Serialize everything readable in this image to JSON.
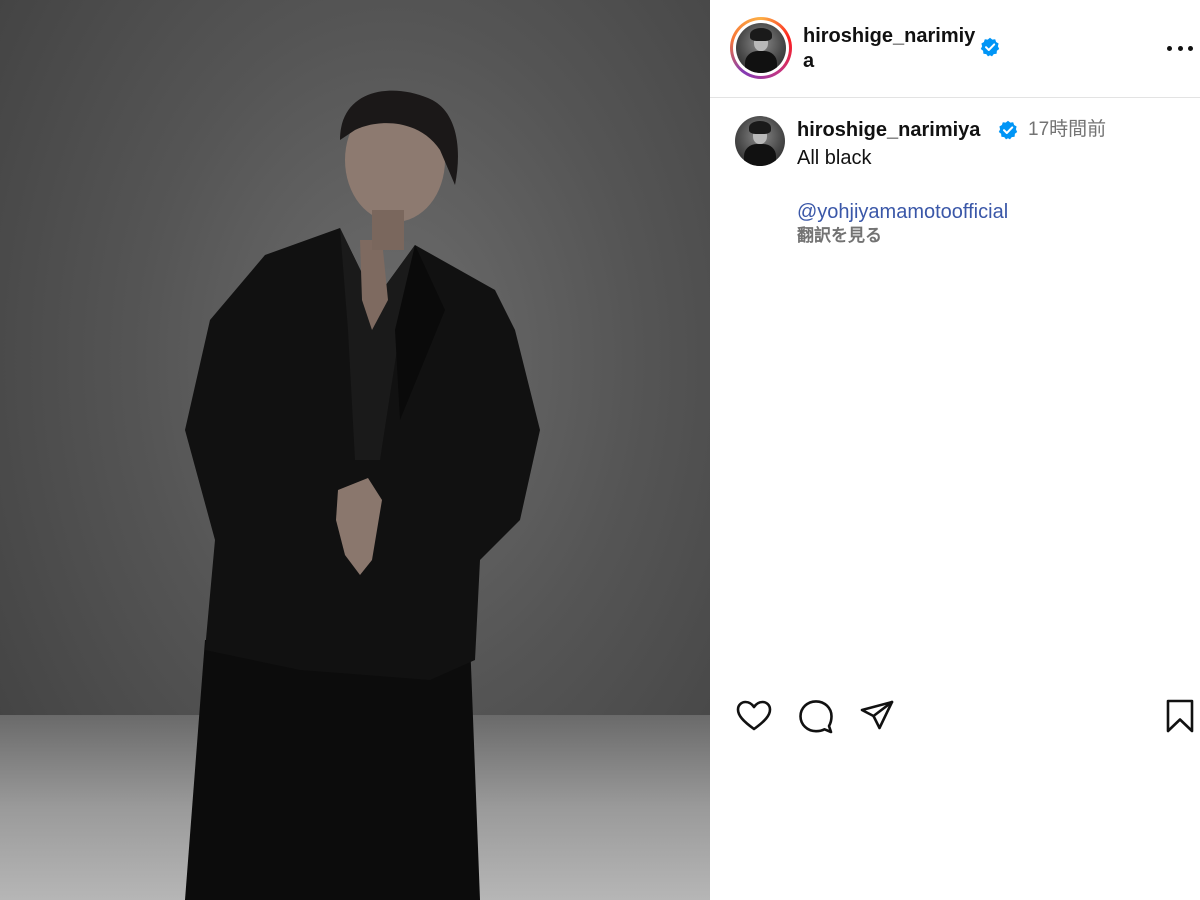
{
  "header": {
    "username": "hiroshige_narimiya",
    "verified": true
  },
  "caption": {
    "username": "hiroshige_narimiya",
    "time": "17時間前",
    "text": "All black",
    "mention": "@yohjiyamamotoofficial",
    "translate": "翻訳を見る"
  },
  "actions": {
    "like_icon": "heart-icon",
    "comment_icon": "comment-icon",
    "share_icon": "paper-plane-icon",
    "save_icon": "bookmark-icon"
  },
  "colors": {
    "verified_blue": "#0095f6",
    "link_blue": "#3a57a8",
    "muted_text": "#737373"
  }
}
